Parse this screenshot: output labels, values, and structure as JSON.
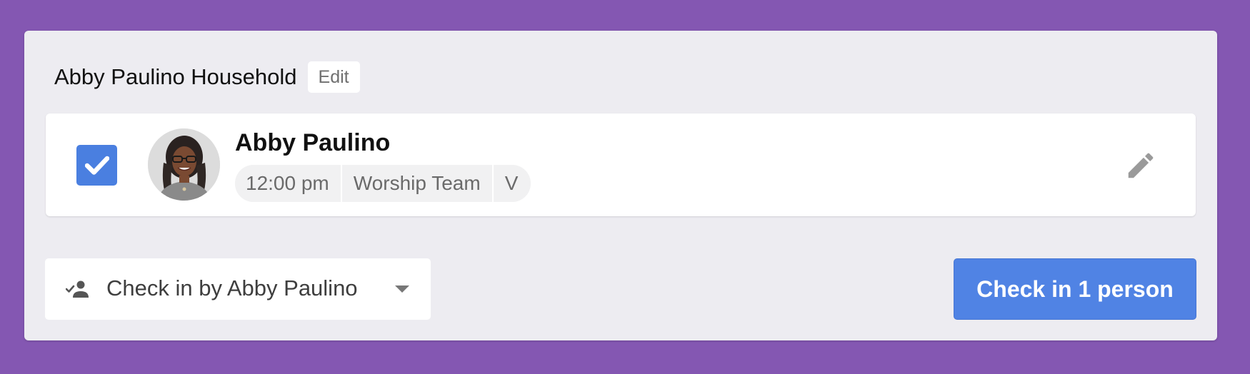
{
  "household": {
    "title": "Abby Paulino Household",
    "edit_label": "Edit"
  },
  "person": {
    "name": "Abby Paulino",
    "checked": true,
    "tags": [
      "12:00 pm",
      "Worship Team",
      "V"
    ],
    "avatar_icon": "person-photo-avatar",
    "edit_icon": "pencil-icon"
  },
  "footer": {
    "checkin_by_label": "Check in by Abby Paulino",
    "checkin_by_icon": "person-check-icon",
    "dropdown_icon": "caret-down-icon",
    "checkin_button_label": "Check in 1 person"
  },
  "colors": {
    "background": "#8457b2",
    "panel": "#edecf1",
    "accent": "#5083e4",
    "checkbox": "#4a7fe0"
  }
}
